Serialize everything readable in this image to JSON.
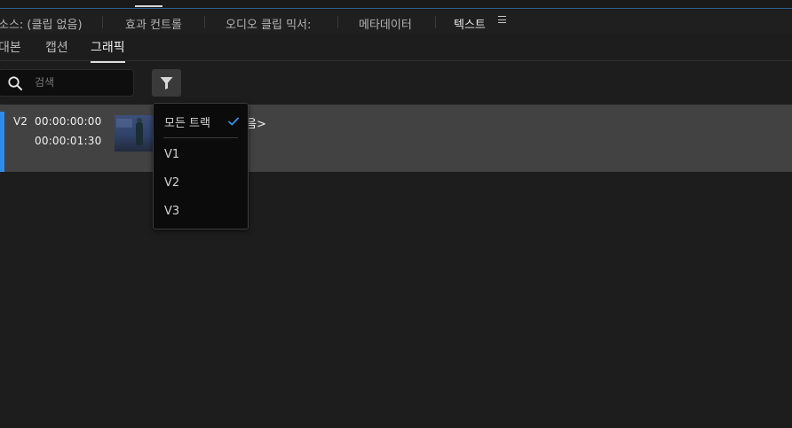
{
  "panel_tabs": {
    "source": "소스: (클립 없음)",
    "effect_controls": "효과 컨트롤",
    "audio_mixer": "오디오 클립 믹서:",
    "metadata": "메타데이터",
    "text": "텍스트",
    "menu_glyph": "≡"
  },
  "sub_tabs": {
    "transcript": "대본",
    "captions": "캡션",
    "graphics": "그래픽"
  },
  "search": {
    "placeholder": "검색",
    "value": ""
  },
  "clip": {
    "track": "V2",
    "timecode_in": "00:00:00:00",
    "timecode_out": "00:00:01:30",
    "name_fragment": "음>"
  },
  "dropdown": {
    "all_tracks": "모든 트랙",
    "check_glyph": "✓",
    "items": [
      "V1",
      "V2",
      "V3"
    ]
  },
  "colors": {
    "accent_blue": "#2d8ceb",
    "row_bg": "#424242",
    "panel_bg": "#1d1d1d"
  },
  "icons": {
    "search": "search-icon",
    "filter": "filter-icon",
    "check": "check-icon",
    "menu": "menu-icon"
  }
}
